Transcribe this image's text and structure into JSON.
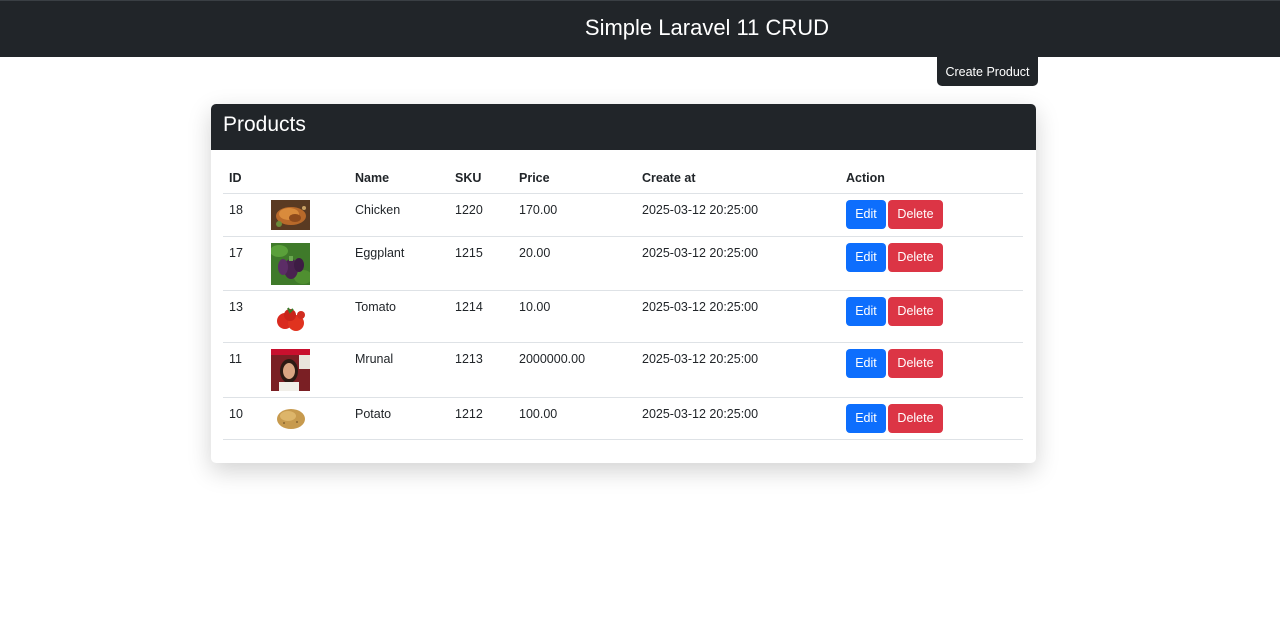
{
  "header": {
    "title": "Simple Laravel 11 CRUD"
  },
  "toolbar": {
    "create_label": "Create Product"
  },
  "card": {
    "title": "Products"
  },
  "table": {
    "columns": [
      "ID",
      "",
      "Name",
      "SKU",
      "Price",
      "Create at",
      "Action"
    ],
    "rows": [
      {
        "id": "18",
        "image": "chicken",
        "name": "Chicken",
        "sku": "1220",
        "price": "170.00",
        "created": "2025-03-12 20:25:00"
      },
      {
        "id": "17",
        "image": "eggplant",
        "name": "Eggplant",
        "sku": "1215",
        "price": "20.00",
        "created": "2025-03-12 20:25:00"
      },
      {
        "id": "13",
        "image": "tomato",
        "name": "Tomato",
        "sku": "1214",
        "price": "10.00",
        "created": "2025-03-12 20:25:00"
      },
      {
        "id": "11",
        "image": "person-photo",
        "name": "Mrunal",
        "sku": "1213",
        "price": "2000000.00",
        "created": "2025-03-12 20:25:00"
      },
      {
        "id": "10",
        "image": "potato",
        "name": "Potato",
        "sku": "1212",
        "price": "100.00",
        "created": "2025-03-12 20:25:00"
      }
    ],
    "actions": {
      "edit_label": "Edit",
      "delete_label": "Delete"
    }
  },
  "colors": {
    "dark": "#212529",
    "primary": "#0d6efd",
    "danger": "#dc3545",
    "border": "#dee2e6"
  }
}
